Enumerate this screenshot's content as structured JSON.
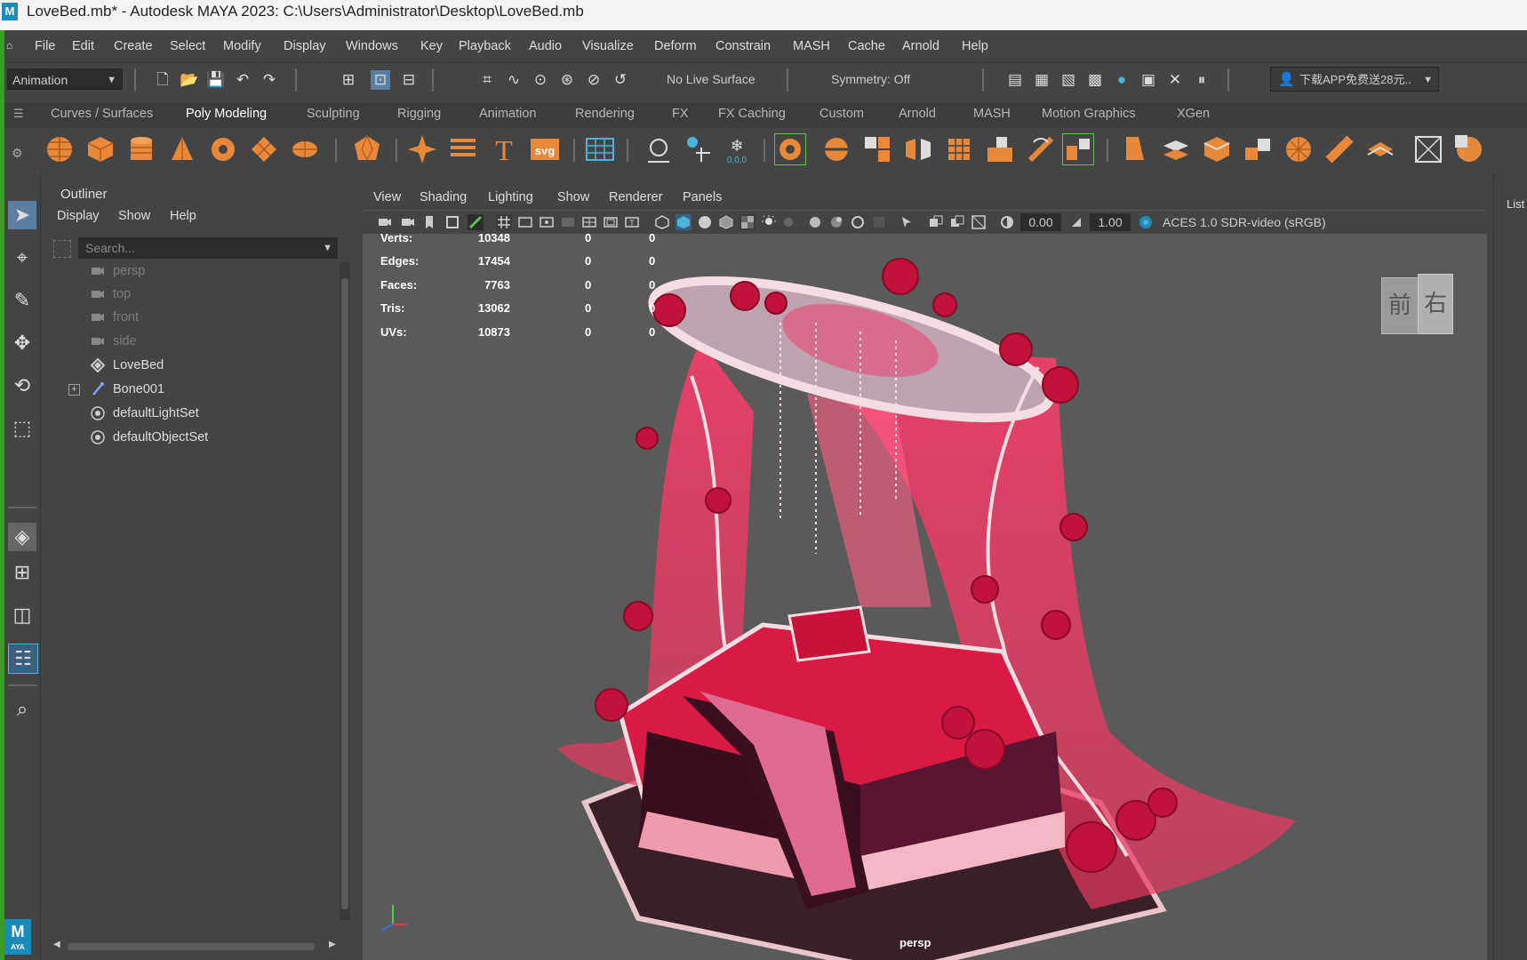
{
  "window": {
    "title": "LoveBed.mb* - Autodesk MAYA 2023: C:\\Users\\Administrator\\Desktop\\LoveBed.mb",
    "app_icon": "M"
  },
  "menubar": [
    "File",
    "Edit",
    "Create",
    "Select",
    "Modify",
    "Display",
    "Windows",
    "Key",
    "Playback",
    "Audio",
    "Visualize",
    "Deform",
    "Constrain",
    "MASH",
    "Cache",
    "Arnold",
    "Help"
  ],
  "statusline": {
    "menuset": "Animation",
    "live_surface": "No Live Surface",
    "symmetry": "Symmetry: Off",
    "account": "下载APP免费送28元.."
  },
  "shelf_tabs": [
    "Curves / Surfaces",
    "Poly Modeling",
    "Sculpting",
    "Rigging",
    "Animation",
    "Rendering",
    "FX",
    "FX Caching",
    "Custom",
    "Arnold",
    "MASH",
    "Motion Graphics",
    "XGen"
  ],
  "shelf_active": "Poly Modeling",
  "shelf_svg_label": "svg",
  "outliner": {
    "title": "Outliner",
    "menu": [
      "Display",
      "Show",
      "Help"
    ],
    "search_placeholder": "Search...",
    "items": [
      {
        "label": "persp",
        "icon": "camera-icon",
        "dim": true
      },
      {
        "label": "top",
        "icon": "camera-icon",
        "dim": true
      },
      {
        "label": "front",
        "icon": "camera-icon",
        "dim": true
      },
      {
        "label": "side",
        "icon": "camera-icon",
        "dim": true
      },
      {
        "label": "LoveBed",
        "icon": "transform-icon",
        "dim": false
      },
      {
        "label": "Bone001",
        "icon": "joint-icon",
        "dim": false,
        "expandable": true
      },
      {
        "label": "defaultLightSet",
        "icon": "set-icon",
        "dim": false
      },
      {
        "label": "defaultObjectSet",
        "icon": "set-icon",
        "dim": false
      }
    ]
  },
  "viewport": {
    "menu": [
      "View",
      "Shading",
      "Lighting",
      "Show",
      "Renderer",
      "Panels"
    ],
    "exposure": "0.00",
    "gamma": "1.00",
    "color_space": "ACES 1.0 SDR-video (sRGB)",
    "camera_label": "persp",
    "viewcube": [
      "前",
      "右"
    ],
    "hud": [
      {
        "label": "Verts:",
        "v1": "10348",
        "v2": "0",
        "v3": "0"
      },
      {
        "label": "Edges:",
        "v1": "17454",
        "v2": "0",
        "v3": "0"
      },
      {
        "label": "Faces:",
        "v1": "7763",
        "v2": "0",
        "v3": "0"
      },
      {
        "label": "Tris:",
        "v1": "13062",
        "v2": "0",
        "v3": "0"
      },
      {
        "label": "UVs:",
        "v1": "10873",
        "v2": "0",
        "v3": "0"
      }
    ]
  },
  "right_panel_label": "List",
  "taskbar_logo_text": "M",
  "taskbar_logo_sub": "AYA",
  "colors": {
    "accent": "#e8893a",
    "maya_blue": "#1b8bb8",
    "green_edge": "#3e9b28",
    "bed_red": "#d91a45",
    "rose": "#c0123a"
  }
}
